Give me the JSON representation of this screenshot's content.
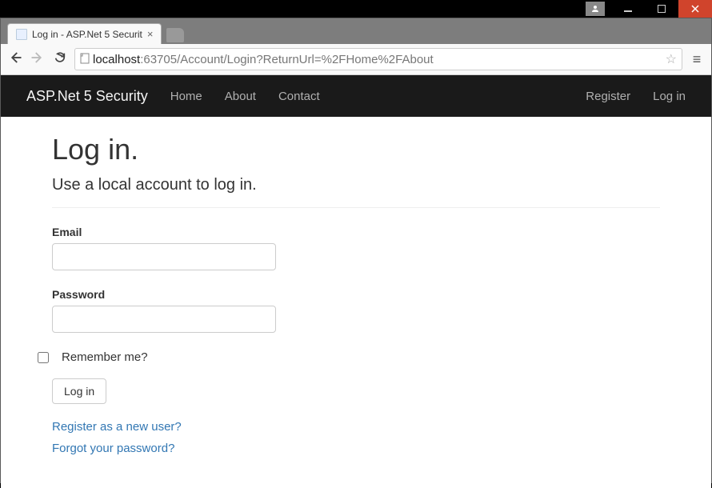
{
  "window": {
    "tab_title": "Log in - ASP.Net 5 Securit",
    "url_host": "localhost",
    "url_port_path": ":63705/Account/Login?ReturnUrl=%2FHome%2FAbout"
  },
  "navbar": {
    "brand": "ASP.Net 5 Security",
    "links": {
      "home": "Home",
      "about": "About",
      "contact": "Contact",
      "register": "Register",
      "login": "Log in"
    }
  },
  "page": {
    "heading": "Log in.",
    "subheading": "Use a local account to log in.",
    "labels": {
      "email": "Email",
      "password": "Password",
      "remember": "Remember me?"
    },
    "button_login": "Log in",
    "link_register": "Register as a new user?",
    "link_forgot": "Forgot your password?"
  }
}
